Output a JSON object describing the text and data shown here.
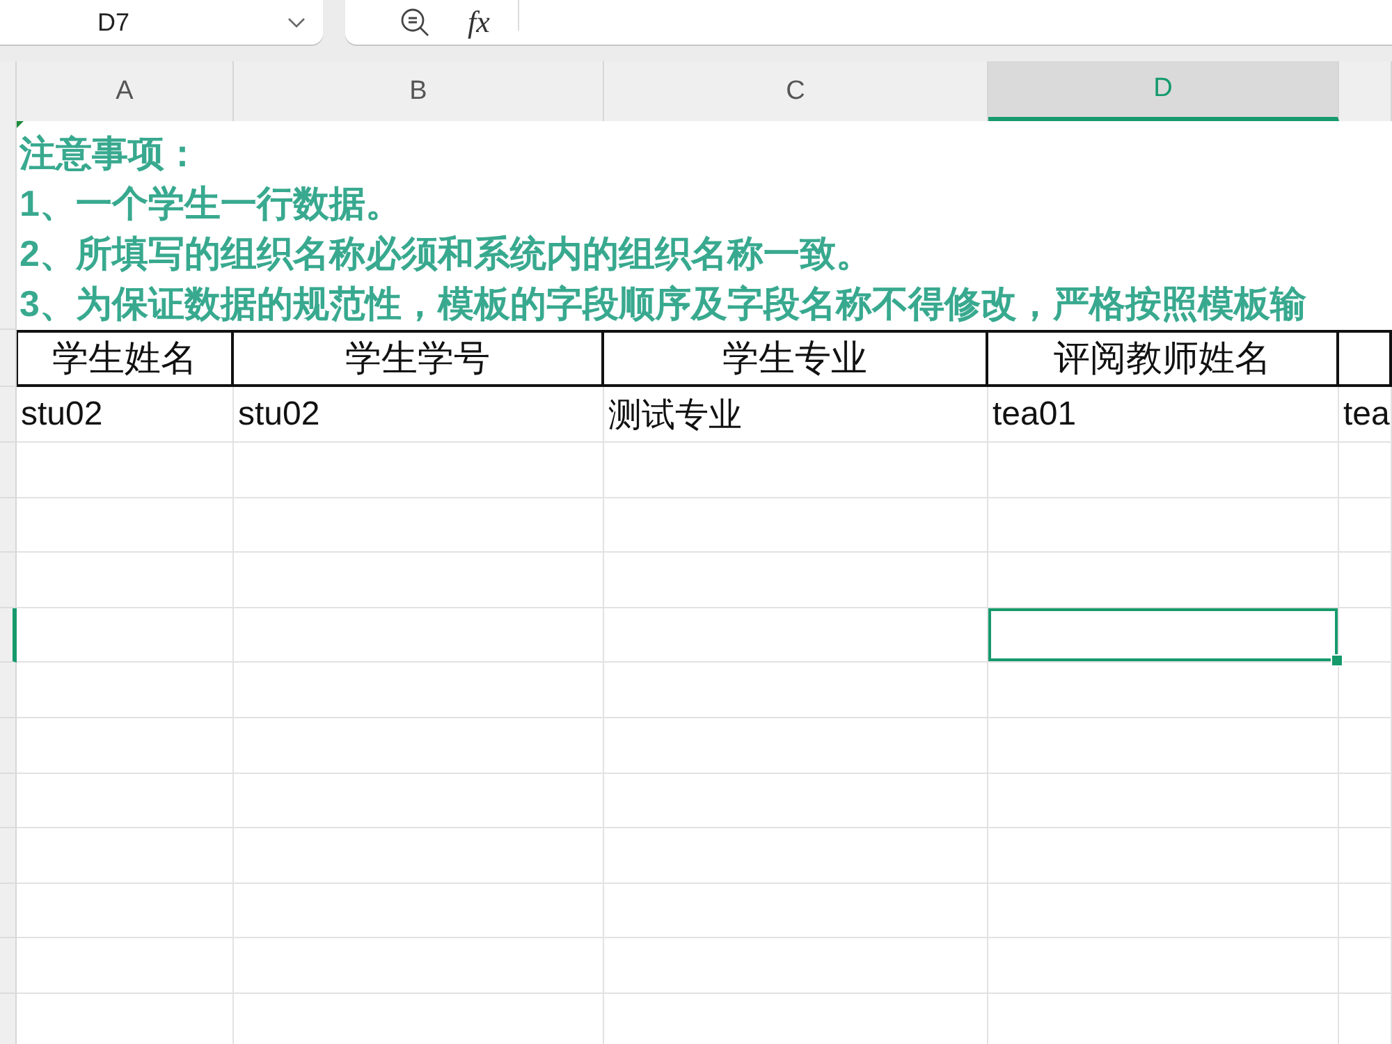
{
  "name_box": {
    "value": "D7"
  },
  "formula_bar": {
    "function_label": "fx"
  },
  "columns": [
    {
      "letter": "A",
      "selected": false
    },
    {
      "letter": "B",
      "selected": false
    },
    {
      "letter": "C",
      "selected": false
    },
    {
      "letter": "D",
      "selected": true
    },
    {
      "selected": false
    }
  ],
  "rows": [
    {
      "kind": "notes",
      "selected": false,
      "title": "注意事项：",
      "items": [
        "1、一个学生一行数据。",
        "2、所填写的组织名称必须和系统内的组织名称一致。",
        "3、为保证数据的规范性，模板的字段顺序及字段名称不得修改，严格按照模板输"
      ]
    },
    {
      "kind": "header",
      "selected": false,
      "cells": [
        "学生姓名",
        "学生学号",
        "学生专业",
        "评阅教师姓名"
      ]
    },
    {
      "kind": "data",
      "selected": false,
      "cells": [
        "stu02",
        "stu02",
        "测试专业",
        "tea01",
        "tea"
      ]
    },
    {
      "kind": "empty",
      "selected": false
    },
    {
      "kind": "empty",
      "selected": false
    },
    {
      "kind": "empty",
      "selected": false
    },
    {
      "kind": "empty",
      "selected": true
    },
    {
      "kind": "empty",
      "selected": false
    },
    {
      "kind": "empty",
      "selected": false
    },
    {
      "kind": "empty",
      "selected": false
    },
    {
      "kind": "empty",
      "selected": false
    },
    {
      "kind": "empty",
      "selected": false
    },
    {
      "kind": "empty",
      "selected": false
    },
    {
      "kind": "empty",
      "selected": false
    }
  ]
}
